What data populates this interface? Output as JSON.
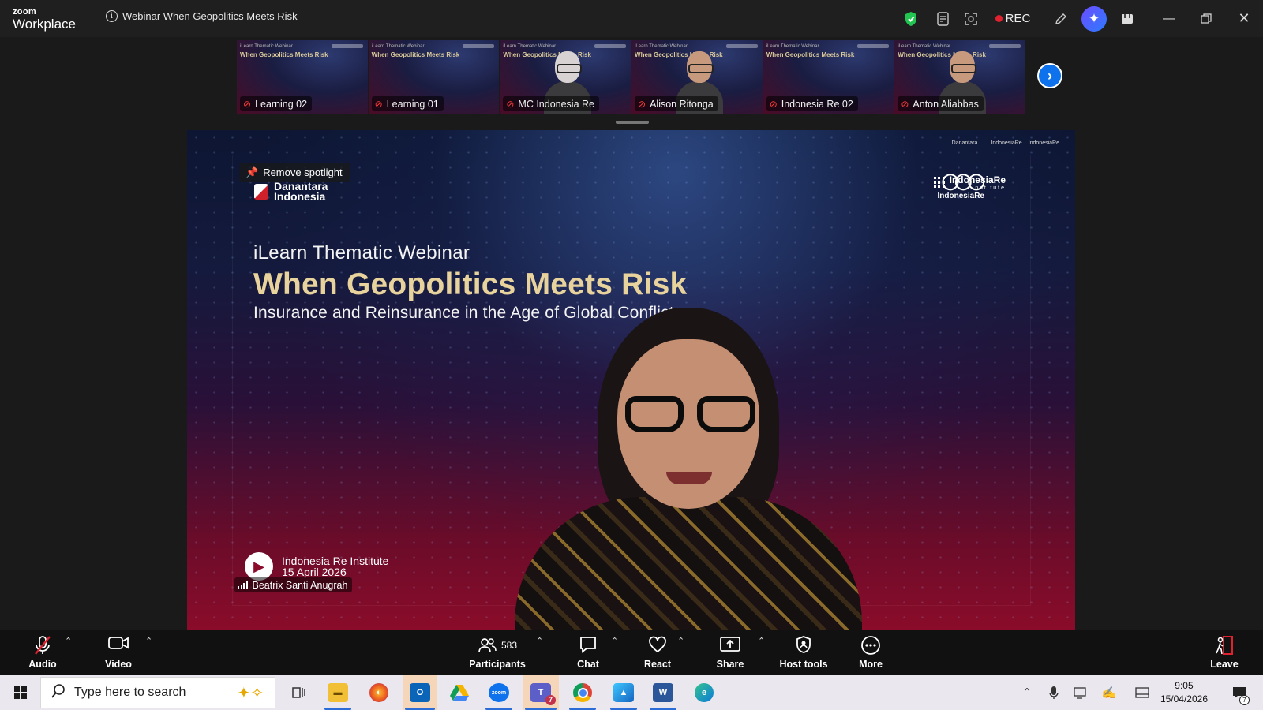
{
  "window": {
    "app_name_line1": "zoom",
    "app_name_line2": "Workplace",
    "meeting_title": "Webinar When Geopolitics Meets Risk",
    "rec_label": "REC"
  },
  "filmstrip": {
    "tiles": [
      {
        "name": "Learning 02",
        "has_person": false
      },
      {
        "name": "Learning 01",
        "has_person": false
      },
      {
        "name": "MC Indonesia Re",
        "has_person": true
      },
      {
        "name": "Alison Ritonga",
        "has_person": true
      },
      {
        "name": "Indonesia Re 02",
        "has_person": false
      },
      {
        "name": "Anton Aliabbas",
        "has_person": true
      }
    ],
    "slide_mini_line1": "iLearn Thematic Webinar",
    "slide_mini_line2": "When Geopolitics Meets Risk"
  },
  "spotlight": {
    "remove_label": "Remove spotlight",
    "speaker_name": "Beatrix Santi Anugrah"
  },
  "slide": {
    "logo_left_line1": "Danantara",
    "logo_left_line2": "Indonesia",
    "logo_mid": "IndonesiaRe",
    "logo_right": "IndonesiaRe",
    "logo_right_sub": "Institute",
    "kicker": "iLearn Thematic Webinar",
    "title": "When Geopolitics Meets Risk",
    "subtitle": "Insurance and Reinsurance in the Age of Global Conflict",
    "org_line1": "Indonesia Re Institute",
    "org_line2": "15 April 2026"
  },
  "toolbar": {
    "audio": "Audio",
    "video": "Video",
    "participants": "Participants",
    "participants_count": "583",
    "chat": "Chat",
    "react": "React",
    "share": "Share",
    "host_tools": "Host tools",
    "more": "More",
    "leave": "Leave"
  },
  "taskbar": {
    "search_placeholder": "Type here to search",
    "time": "9:05",
    "date": "15/04/2026",
    "notification_count": "7"
  },
  "colors": {
    "accent_blue": "#0e72ed",
    "rec_red": "#e0212f",
    "slide_title_gold": "#e9d39c"
  }
}
